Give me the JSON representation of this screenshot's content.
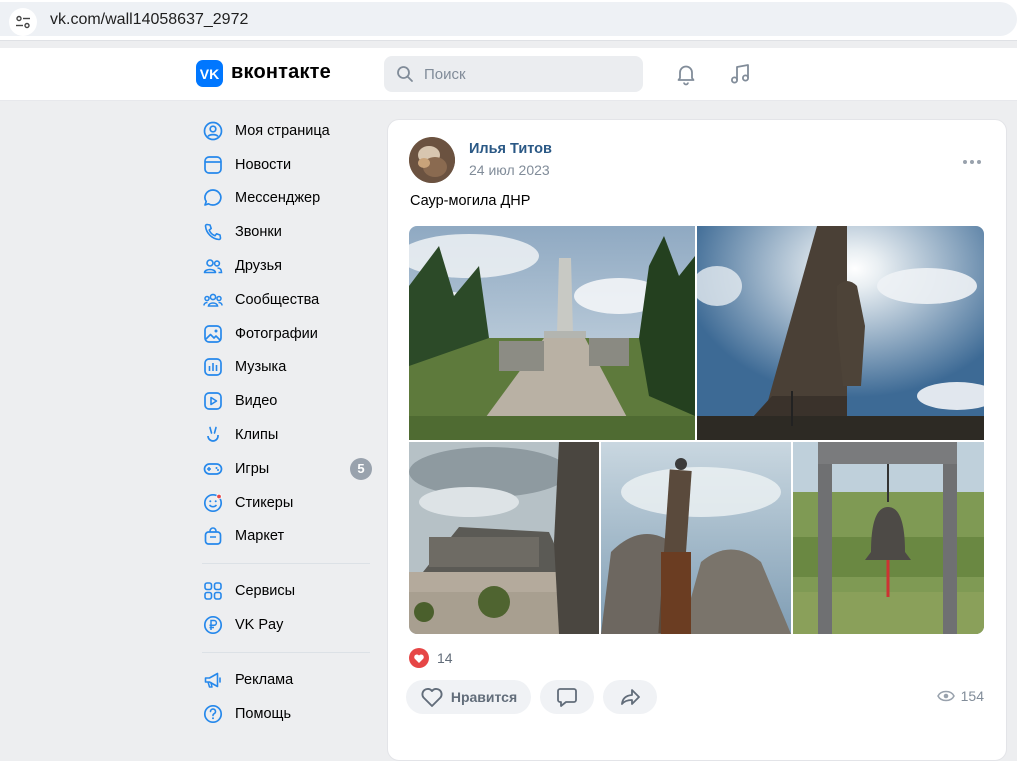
{
  "browser": {
    "url": "vk.com/wall14058637_2972"
  },
  "header": {
    "logo_letters": "VK",
    "logo_text": "вконтакте",
    "search_placeholder": "Поиск"
  },
  "sidebar": {
    "items": [
      {
        "label": "Моя страница",
        "icon": "user-circle-icon"
      },
      {
        "label": "Новости",
        "icon": "newsfeed-icon"
      },
      {
        "label": "Мессенджер",
        "icon": "message-icon"
      },
      {
        "label": "Звонки",
        "icon": "phone-icon"
      },
      {
        "label": "Друзья",
        "icon": "friends-icon"
      },
      {
        "label": "Сообщества",
        "icon": "communities-icon"
      },
      {
        "label": "Фотографии",
        "icon": "photos-icon"
      },
      {
        "label": "Музыка",
        "icon": "music-icon"
      },
      {
        "label": "Видео",
        "icon": "video-icon"
      },
      {
        "label": "Клипы",
        "icon": "clips-icon"
      },
      {
        "label": "Игры",
        "icon": "games-icon",
        "badge": "5"
      },
      {
        "label": "Стикеры",
        "icon": "stickers-icon"
      },
      {
        "label": "Маркет",
        "icon": "market-icon"
      }
    ],
    "group2": [
      {
        "label": "Сервисы",
        "icon": "services-icon"
      },
      {
        "label": "VK Pay",
        "icon": "vkpay-icon"
      }
    ],
    "group3": [
      {
        "label": "Реклама",
        "icon": "ads-icon"
      },
      {
        "label": "Помощь",
        "icon": "help-icon"
      }
    ]
  },
  "post": {
    "author": "Илья Титов",
    "date": "24 июл 2023",
    "text": "Саур-могила ДНР",
    "likes": "14",
    "like_label": "Нравится",
    "views": "154"
  },
  "colors": {
    "accent": "#0077ff",
    "link": "#2a5885",
    "like_red": "#e64646",
    "badge": "#99a2ad"
  }
}
